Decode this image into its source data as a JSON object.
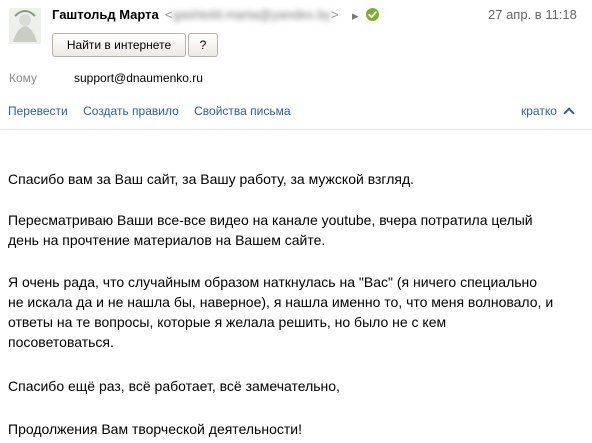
{
  "header": {
    "sender_name": "Гаштольд Марта",
    "sender_email_open": "<",
    "sender_email_blurred": "gashtold.marta@yandex.by",
    "sender_email_close": ">",
    "date": "27 апр. в 11:18",
    "search_button_label": "Найти в интернете",
    "help_button_label": "?",
    "to_label": "Кому",
    "to_value": "support@dnaumenko.ru"
  },
  "actions": {
    "translate_label": "Перевести",
    "create_rule_label": "Создать правило",
    "letter_properties_label": "Свойства письма",
    "brief_label": "кратко"
  },
  "body": {
    "p1": [
      "Спасибо вам за Ваш сайт, за Вашу работу, за мужской взгляд."
    ],
    "p2": [
      "Пересматриваю Ваши все-все видео на канале youtube, вчера потратила целый",
      "день на прочтение материалов на Вашем сайте."
    ],
    "p3": [
      "Я очень рада, что случайным образом наткнулась на \"Вас\" (я ничего специально",
      "не искала да и не нашла бы, наверное), я нашла именно то, что меня волновало, и",
      "ответы на те вопросы, которые я желала решить, но было не с кем",
      "посоветоваться."
    ],
    "p4": [
      "Спасибо ещё раз, всё работает, всё замечательно,"
    ],
    "p5": [
      "Продолжения Вам творческой деятельности!"
    ]
  },
  "colors": {
    "link": "#2b5eac",
    "verified_badge": "#7bb12a"
  }
}
